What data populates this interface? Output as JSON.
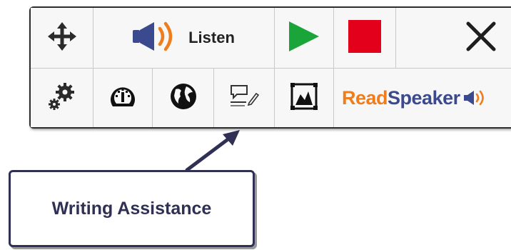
{
  "toolbar": {
    "listen_label": "Listen",
    "brand_read": "Read",
    "brand_speaker": "Speaker",
    "icons": {
      "move": "move-arrows-icon",
      "speaker": "speaker-icon",
      "play": "play-icon",
      "stop": "stop-icon",
      "close": "close-icon",
      "settings": "gears-icon",
      "speed": "speedometer-icon",
      "translate": "globe-icon",
      "writing": "writing-assistance-icon",
      "picture": "picture-icon",
      "brand_speaker": "brand-speaker-icon"
    },
    "colors": {
      "play": "#1aa53a",
      "stop": "#e3001b",
      "speaker_body": "#3b4a8f",
      "speaker_waves": "#f07d1b",
      "brand_read": "#f07d1b",
      "brand_speaker": "#3b4a8f"
    }
  },
  "callout": {
    "label": "Writing Assistance",
    "border_color": "#2f3054"
  }
}
